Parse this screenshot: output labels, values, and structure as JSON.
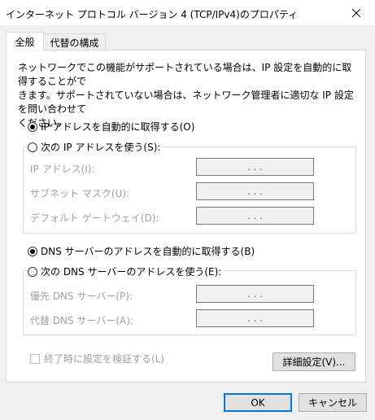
{
  "window": {
    "title": "インターネット プロトコル バージョン 4 (TCP/IPv4)のプロパティ",
    "close_icon": "close-icon"
  },
  "tabs": [
    {
      "label": "全般",
      "selected": true
    },
    {
      "label": "代替の構成",
      "selected": false
    }
  ],
  "description_lines": [
    "ネットワークでこの機能がサポートされている場合は、IP 設定を自動的に取得することがで",
    "きます。サポートされていない場合は、ネットワーク管理者に適切な IP 設定を問い合わせて",
    "ください。"
  ],
  "ip_section": {
    "auto_label": "IP アドレスを自動的に取得する(O)",
    "auto_selected": true,
    "manual_label": "次の IP アドレスを使う(S):",
    "manual_selected": false,
    "fields": [
      {
        "label": "IP アドレス(I):",
        "value": ". . ."
      },
      {
        "label": "サブネット マスク(U):",
        "value": ". . ."
      },
      {
        "label": "デフォルト ゲートウェイ(D):",
        "value": ". . ."
      }
    ]
  },
  "dns_section": {
    "auto_label": "DNS サーバーのアドレスを自動的に取得する(B)",
    "auto_selected": true,
    "manual_label": "次の DNS サーバーのアドレスを使う(E):",
    "manual_selected": false,
    "fields": [
      {
        "label": "優先 DNS サーバー(P):",
        "value": ". . ."
      },
      {
        "label": "代替 DNS サーバー(A):",
        "value": ". . ."
      }
    ]
  },
  "validate_checkbox": {
    "label": "終了時に設定を検証する(L)",
    "checked": false,
    "enabled": false
  },
  "buttons": {
    "advanced": "詳細設定(V)...",
    "ok": "OK",
    "cancel": "キャンセル"
  },
  "colors": {
    "accent": "#0078d7",
    "disabled_text": "#a0a0a0"
  }
}
